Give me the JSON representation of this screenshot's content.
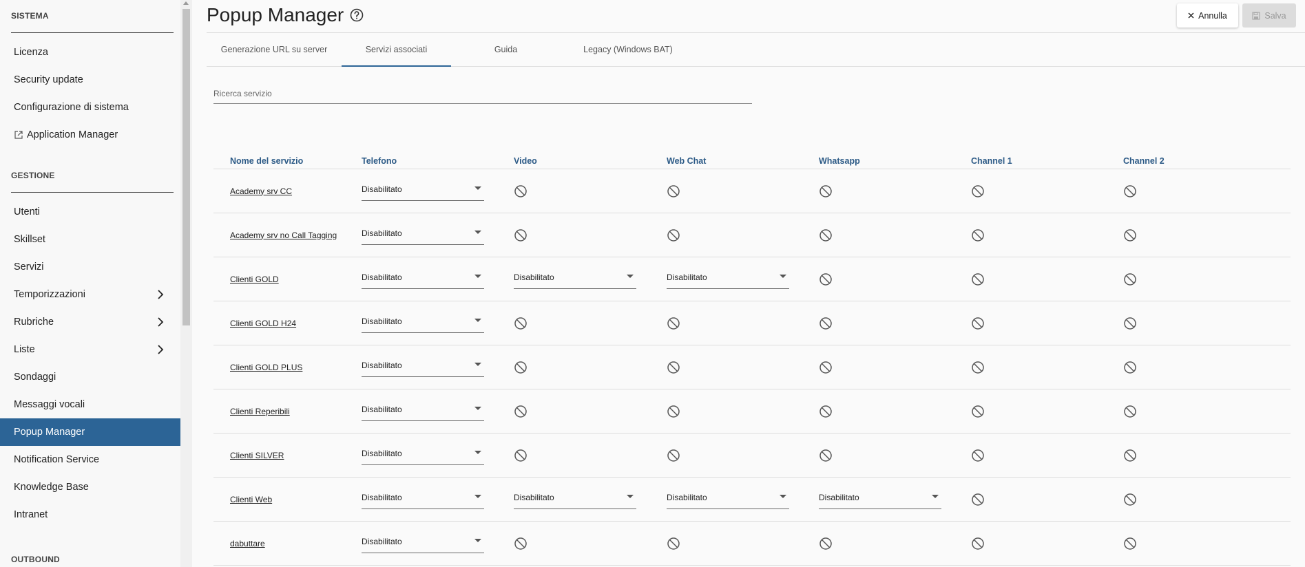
{
  "sidebar": {
    "sistema_title": "SISTEMA",
    "sistema_items": [
      "Licenza",
      "Security update",
      "Configurazione di sistema",
      "Application Manager"
    ],
    "gestione_title": "GESTIONE",
    "gestione_items": [
      "Utenti",
      "Skillset",
      "Servizi",
      "Temporizzazioni",
      "Rubriche",
      "Liste",
      "Sondaggi",
      "Messaggi vocali",
      "Popup Manager",
      "Notification Service",
      "Knowledge Base",
      "Intranet"
    ],
    "outbound_title": "OUTBOUND",
    "active_item": "Popup Manager"
  },
  "header": {
    "title": "Popup Manager",
    "cancel_label": "Annulla",
    "save_label": "Salva"
  },
  "tabs": [
    "Generazione URL su server",
    "Servizi associati",
    "Guida",
    "Legacy (Windows BAT)"
  ],
  "active_tab": "Servizi associati",
  "search": {
    "placeholder": "Ricerca servizio"
  },
  "table": {
    "columns": [
      "Nome del servizio",
      "Telefono",
      "Video",
      "Web Chat",
      "Whatsapp",
      "Channel 1",
      "Channel 2"
    ],
    "rows": [
      {
        "name": "Academy srv CC",
        "cells": [
          "Disabilitato",
          null,
          null,
          null,
          null,
          null
        ]
      },
      {
        "name": "Academy srv no Call Tagging",
        "cells": [
          "Disabilitato",
          null,
          null,
          null,
          null,
          null
        ]
      },
      {
        "name": "Clienti GOLD",
        "cells": [
          "Disabilitato",
          "Disabilitato",
          "Disabilitato",
          null,
          null,
          null
        ]
      },
      {
        "name": "Clienti GOLD H24",
        "cells": [
          "Disabilitato",
          null,
          null,
          null,
          null,
          null
        ]
      },
      {
        "name": "Clienti GOLD PLUS",
        "cells": [
          "Disabilitato",
          null,
          null,
          null,
          null,
          null
        ]
      },
      {
        "name": "Clienti Reperibili",
        "cells": [
          "Disabilitato",
          null,
          null,
          null,
          null,
          null
        ]
      },
      {
        "name": "Clienti SILVER",
        "cells": [
          "Disabilitato",
          null,
          null,
          null,
          null,
          null
        ]
      },
      {
        "name": "Clienti Web",
        "cells": [
          "Disabilitato",
          "Disabilitato",
          "Disabilitato",
          "Disabilitato",
          null,
          null
        ]
      },
      {
        "name": "dabuttare",
        "cells": [
          "Disabilitato",
          null,
          null,
          null,
          null,
          null
        ]
      }
    ]
  },
  "colors": {
    "accent": "#2c6496",
    "header_text": "#2c5a86"
  },
  "icons": {
    "disabled": "ban-icon",
    "help": "help-circle-icon",
    "close": "close-icon",
    "save": "save-icon",
    "external": "external-link-icon",
    "chevron": "chevron-right-icon"
  }
}
